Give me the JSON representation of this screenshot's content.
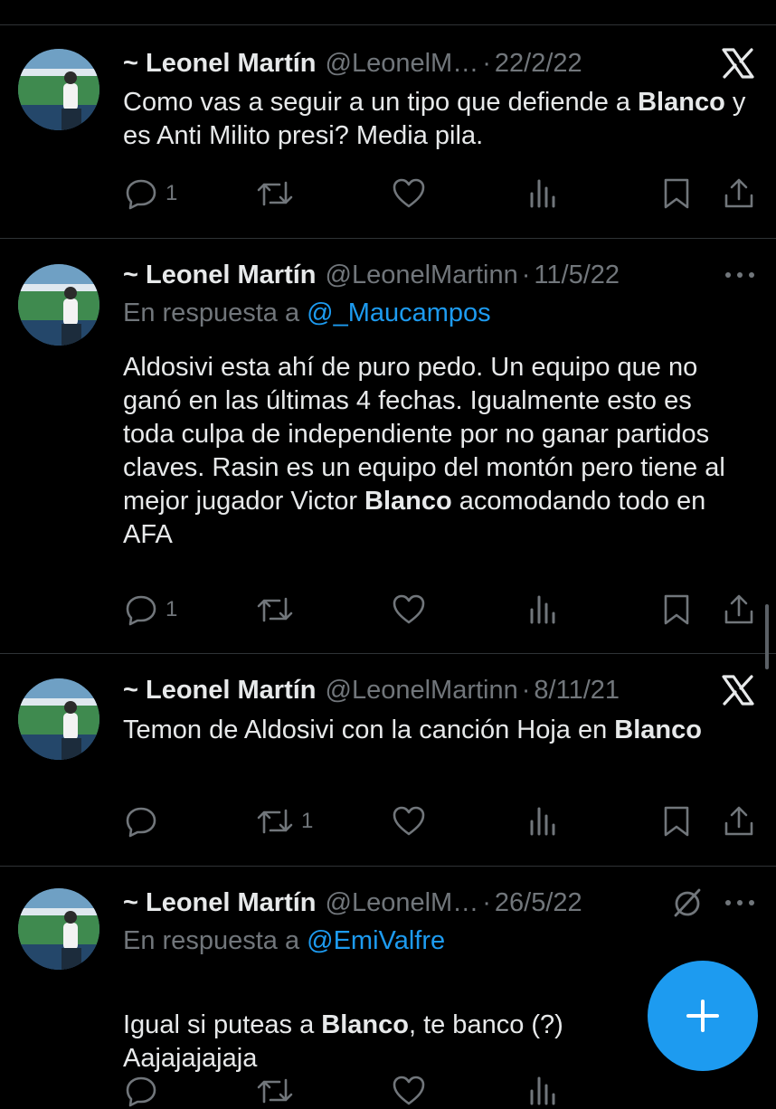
{
  "tweets": [
    {
      "name": "~ Leonel Martín",
      "handle": "@LeonelM…",
      "dot": "·",
      "date": "22/2/22",
      "header_icon": "x-logo-icon",
      "reply_prefix": "",
      "reply_to": "",
      "text_parts": [
        [
          "Como vas a seguir a un tipo que defiende a ",
          false
        ],
        [
          "Blanco",
          true
        ],
        [
          " y es Anti Milito presi? Media pila.",
          false
        ]
      ],
      "reply_count": "1",
      "retweet_count": "",
      "like_count": ""
    },
    {
      "name": "~ Leonel Martín",
      "handle": "@LeonelMartinn",
      "dot": "·",
      "date": "11/5/22",
      "header_icon": "more-icon",
      "reply_prefix": "En respuesta a ",
      "reply_to": "@_Maucampos",
      "text_parts": [
        [
          "Aldosivi esta ahí de puro pedo. Un equipo que no ganó en las últimas 4 fechas. Igualmente esto es toda culpa de independiente por no ganar partidos claves. Rasin es un equipo del montón pero tiene al mejor jugador Victor ",
          false
        ],
        [
          "Blanco",
          true
        ],
        [
          " acomodando todo en AFA",
          false
        ]
      ],
      "reply_count": "1",
      "retweet_count": "",
      "like_count": ""
    },
    {
      "name": "~ Leonel Martín",
      "handle": "@LeonelMartinn",
      "dot": "·",
      "date": "8/11/21",
      "header_icon": "x-logo-icon",
      "reply_prefix": "",
      "reply_to": "",
      "text_parts": [
        [
          "Temon de Aldosivi con la canción Hoja en ",
          false
        ],
        [
          "Blanco",
          true
        ]
      ],
      "reply_count": "",
      "retweet_count": "1",
      "like_count": ""
    },
    {
      "name": "~ Leonel Martín",
      "handle": "@LeonelM…",
      "dot": "·",
      "date": "26/5/22",
      "header_icon": "more-icon",
      "reply_prefix": "En respuesta a ",
      "reply_to": "@EmiValfre",
      "text_parts": [
        [
          "Igual si puteas a ",
          false
        ],
        [
          "Blanco",
          true
        ],
        [
          ", te banco (?)\nAajajajajaja",
          false
        ]
      ],
      "reply_count": "",
      "retweet_count": "",
      "like_count": ""
    }
  ],
  "fab": {
    "icon": "plus-icon",
    "color": "#1d9bf0"
  },
  "colors": {
    "background": "#000000",
    "text": "#e7e9ea",
    "muted": "#71767b",
    "accent": "#1d9bf0",
    "divider": "#2f3336"
  }
}
